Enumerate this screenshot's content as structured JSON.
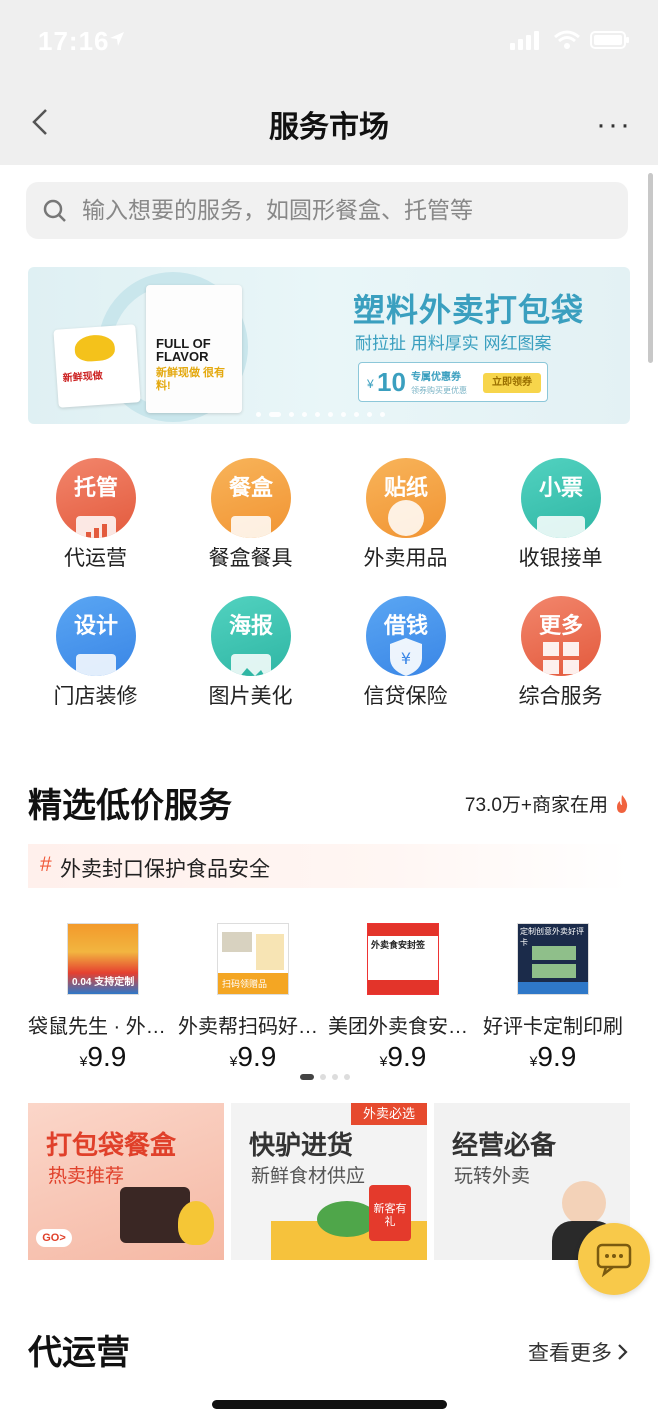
{
  "status_bar": {
    "time": "17:16"
  },
  "nav": {
    "title": "服务市场",
    "more": "···"
  },
  "search": {
    "placeholder": "输入想要的服务，如圆形餐盒、托管等"
  },
  "banner": {
    "title": "塑料外卖打包袋",
    "subtitle": "耐拉扯 用料厚实 网红图案",
    "coupon_currency": "¥",
    "coupon_amount": "10",
    "coupon_label": "专属优惠券",
    "coupon_note": "领券购买更优惠",
    "coupon_button": "立即领券",
    "bag_text_1": "新鲜现做",
    "bag_text_2": "FULL OF FLAVOR",
    "bag_text_3": "新鲜现做 很有料!"
  },
  "categories": [
    {
      "tag": "托管",
      "label": "代运营",
      "color": "#ee6a4e",
      "icon": "chart-icon"
    },
    {
      "tag": "餐盒",
      "label": "餐盒餐具",
      "color": "#f6a441",
      "icon": "box-icon"
    },
    {
      "tag": "贴纸",
      "label": "外卖用品",
      "color": "#f6a441",
      "icon": "sticker-icon"
    },
    {
      "tag": "小票",
      "label": "收银接单",
      "color": "#3fc5b3",
      "icon": "printer-icon"
    },
    {
      "tag": "设计",
      "label": "门店装修",
      "color": "#3c90ee",
      "icon": "brush-icon"
    },
    {
      "tag": "海报",
      "label": "图片美化",
      "color": "#3fc5b3",
      "icon": "image-icon"
    },
    {
      "tag": "借钱",
      "label": "信贷保险",
      "color": "#3c90ee",
      "icon": "shield-yen-icon"
    },
    {
      "tag": "更多",
      "label": "综合服务",
      "color": "#ee6a4e",
      "icon": "grid-icon"
    }
  ],
  "featured": {
    "title": "精选低价服务",
    "merchant_count": "73.0万+商家在用",
    "tagline_hash": "#",
    "tagline": "外卖封口保护食品安全"
  },
  "products": [
    {
      "name": "袋鼠先生 · 外卖封口贴",
      "currency": "¥",
      "price": "9.9",
      "img_text": "0.04 支持定制"
    },
    {
      "name": "外卖帮扫码好评贴",
      "currency": "¥",
      "price": "9.9",
      "img_text": "扫码领赠品"
    },
    {
      "name": "美团外卖食安封签",
      "currency": "¥",
      "price": "9.9",
      "img_text": "外卖食安封签"
    },
    {
      "name": "好评卡定制印刷",
      "currency": "¥",
      "price": "9.9",
      "img_text": "定制创意外卖好评卡"
    }
  ],
  "promos": [
    {
      "title": "打包袋餐盒",
      "subtitle": "热卖推荐",
      "badge": "GO>"
    },
    {
      "title": "快驴进货",
      "subtitle": "新鲜食材供应",
      "tag": "外卖必选",
      "gift": "新客有礼"
    },
    {
      "title": "经营必备",
      "subtitle": "玩转外卖"
    }
  ],
  "section2": {
    "title": "代运营",
    "more": "查看更多"
  }
}
